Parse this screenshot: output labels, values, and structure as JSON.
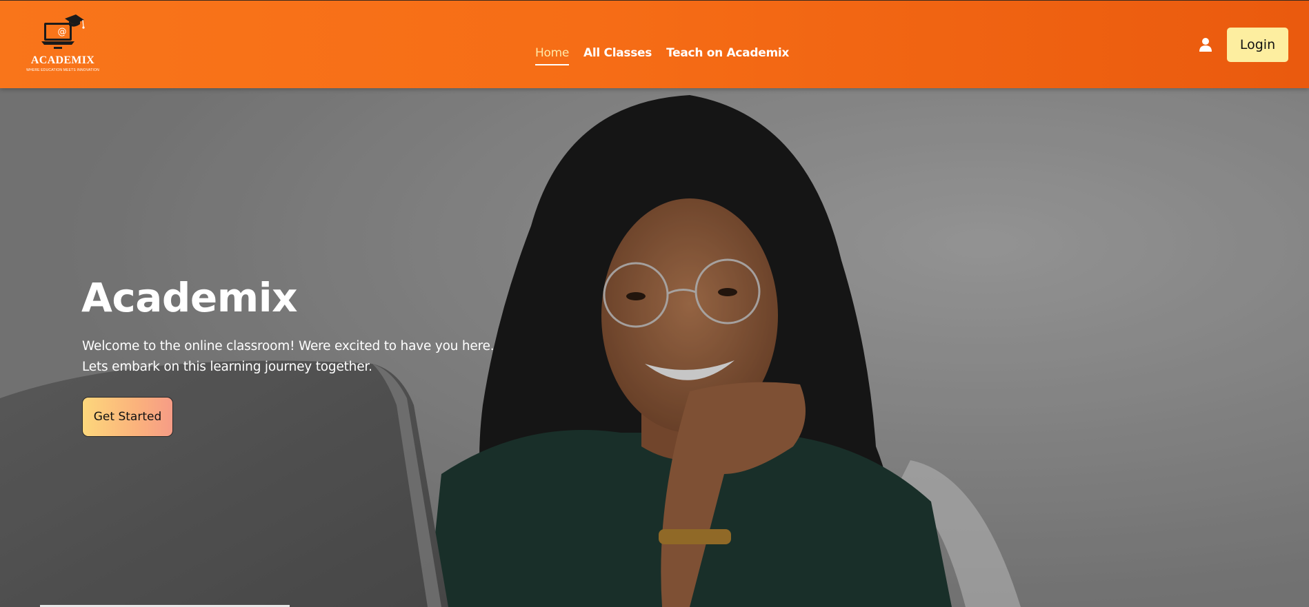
{
  "brand": {
    "logo_symbol": "@",
    "name": "ACADEMIX",
    "tagline": "WHERE EDUCATION MEETS INNOVATION",
    "logo_icon": "laptop-graduation-cap-icon"
  },
  "nav": {
    "items": [
      {
        "label": "Home",
        "active": true
      },
      {
        "label": "All Classes",
        "active": false
      },
      {
        "label": "Teach on Academix",
        "active": false
      }
    ]
  },
  "header_actions": {
    "user_icon": "user-icon",
    "login_label": "Login"
  },
  "hero": {
    "title": "Academix",
    "description_line1": "Welcome to the online classroom! Were excited to have you here.",
    "description_line2": "Lets embark on this learning journey together.",
    "cta_label": "Get Started"
  },
  "colors": {
    "header_orange": "#f9751a",
    "login_bg": "#fdeea0",
    "active_nav": "#ffe9a8",
    "cta_gradient_start": "#fcd77c",
    "cta_gradient_end": "#f69c86"
  }
}
